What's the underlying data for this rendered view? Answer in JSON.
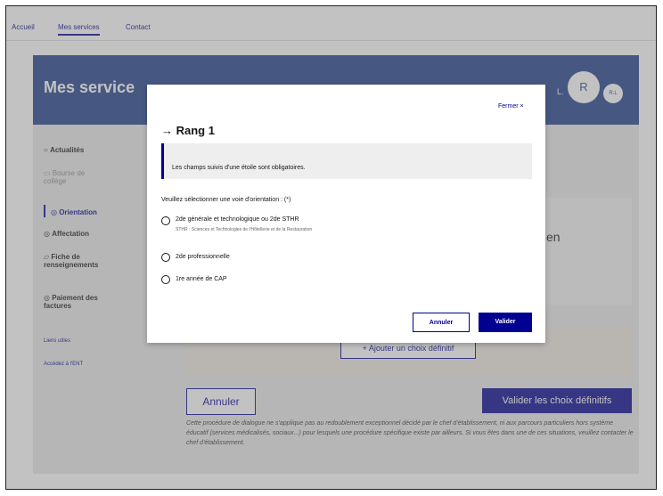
{
  "nav": {
    "items": [
      {
        "label": "Accueil"
      },
      {
        "label": "Mes services"
      },
      {
        "label": "Contact"
      }
    ]
  },
  "banner": {
    "title": "Mes service",
    "user_initial": "L.",
    "avatar_big": "R",
    "avatar_small": "R.L"
  },
  "sidebar": {
    "items": [
      {
        "label": "Actualités"
      },
      {
        "label": "Bourse de collège"
      },
      {
        "label": "Orientation"
      },
      {
        "label": "Affectation"
      },
      {
        "label": "Fiche de renseignements"
      },
      {
        "label": "Paiement des factures"
      }
    ],
    "links": [
      {
        "label": "Liens utiles"
      },
      {
        "label": "Accédez à l'ENT"
      }
    ]
  },
  "main": {
    "card_text": "is en",
    "add_choice": "+ Ajouter un choix définitif",
    "cancel": "Annuler",
    "validate": "Valider les choix définitifs",
    "notice": "Cette procédure de dialogue ne s'applique pas au redoublement exceptionnel décidé par le chef d'établissement, ni aux parcours particuliers hors système éducatif (services médicalisés, sociaux...) pour lesquels une procédure spécifique existe par ailleurs. Si vous êtes dans une de ces situations, veuillez contacter le chef d'établissement."
  },
  "modal": {
    "close_label": "Fermer ×",
    "title": "→ Rang 1",
    "info": "Les champs suivis d'une étoile sont obligatoires.",
    "legend": "Veuillez sélectionner une voie d'orientation : (*)",
    "options": [
      {
        "label": "2de générale et technologique ou 2de STHR",
        "hint": "STHR : Sciences et Technologies de l'Hôtellerie et de la Restauration"
      },
      {
        "label": "2de professionnelle",
        "hint": ""
      },
      {
        "label": "1re année de CAP",
        "hint": ""
      }
    ],
    "cancel": "Annuler",
    "validate": "Valider"
  },
  "colors": {
    "primary": "#000091",
    "banner": "#1e3f8a"
  }
}
